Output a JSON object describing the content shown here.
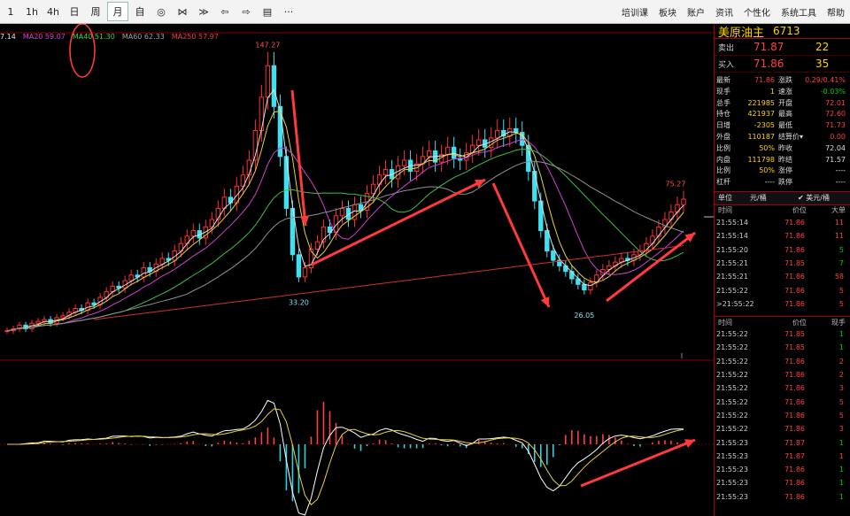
{
  "toolbar": {
    "buttons": [
      {
        "id": "1m",
        "label": "1"
      },
      {
        "id": "1h",
        "label": "1h"
      },
      {
        "id": "4h",
        "label": "4h"
      },
      {
        "id": "day",
        "label": "日"
      },
      {
        "id": "week",
        "label": "周"
      },
      {
        "id": "month",
        "label": "月",
        "selected": true
      },
      {
        "id": "custom",
        "label": "自"
      },
      {
        "id": "target",
        "label": "◎"
      },
      {
        "id": "bowtie",
        "label": "⋈"
      },
      {
        "id": "fold",
        "label": "≫"
      },
      {
        "id": "back",
        "label": "⇦"
      },
      {
        "id": "fwd",
        "label": "⇨"
      },
      {
        "id": "layout",
        "label": "▤"
      },
      {
        "id": "more",
        "label": "···"
      }
    ],
    "menus": [
      "培训课",
      "板块",
      "账户",
      "资讯",
      "个性化",
      "系统工具",
      "帮助"
    ]
  },
  "ma_legend": [
    {
      "label": "7.14",
      "color": "#e0e0e0"
    },
    {
      "label": "MA20 59.07",
      "color": "#d040d0"
    },
    {
      "label": "MA40 51.30",
      "color": "#40d040"
    },
    {
      "label": "MA60 62.33",
      "color": "#a0a0a0"
    },
    {
      "label": "MA250 57.97",
      "color": "#e04040"
    }
  ],
  "annotations": {
    "high": "147.27",
    "low1": "33.20",
    "low2": "26.05",
    "recent": "75.27"
  },
  "chart_data": {
    "type": "candlestick",
    "price_series": [
      4,
      5,
      7,
      5,
      8,
      9,
      10,
      8,
      11,
      12,
      14,
      16,
      15,
      19,
      18,
      22,
      25,
      28,
      27,
      31,
      34,
      33,
      38,
      36,
      40,
      43,
      42,
      47,
      51,
      55,
      58,
      54,
      60,
      64,
      70,
      76,
      73,
      82,
      88,
      96,
      112,
      130,
      147,
      125,
      98,
      70,
      45,
      33,
      38,
      48,
      52,
      60,
      57,
      66,
      70,
      64,
      72,
      69,
      78,
      83,
      88,
      91,
      86,
      93,
      96,
      90,
      94,
      98,
      101,
      95,
      99,
      103,
      97,
      96,
      100,
      104,
      107,
      103,
      108,
      112,
      109,
      113,
      111,
      104,
      90,
      74,
      58,
      47,
      42,
      39,
      36,
      32,
      29,
      26,
      30,
      34,
      37,
      39,
      41,
      43,
      42,
      45,
      47,
      51,
      55,
      60,
      64,
      68,
      72,
      75
    ],
    "ylim": [
      0,
      160
    ]
  },
  "panel": {
    "name": "美原油主",
    "code": "6713",
    "sell": {
      "label": "卖出",
      "price": "71.87",
      "vol": "22"
    },
    "buy": {
      "label": "买入",
      "price": "71.86",
      "vol": "35"
    },
    "quotes": [
      {
        "l1": "最新",
        "v1": "71.86",
        "c1": "#ff4040",
        "l2": "涨跌",
        "v2": "0.29/0.41%",
        "c2": "#ff4040"
      },
      {
        "l1": "现手",
        "v1": "1",
        "c1": "#ffd200",
        "l2": "速涨",
        "v2": "-0.03%",
        "c2": "#00d000"
      },
      {
        "l1": "总手",
        "v1": "221985",
        "c1": "#ffd200",
        "l2": "开盘",
        "v2": "72.01",
        "c2": "#ff4040"
      },
      {
        "l1": "持仓",
        "v1": "421937",
        "c1": "#ffd200",
        "l2": "最高",
        "v2": "72.60",
        "c2": "#ff4040"
      },
      {
        "l1": "日增",
        "v1": "-2305",
        "c1": "#ffd200",
        "l2": "最低",
        "v2": "71.73",
        "c2": "#ff4040"
      },
      {
        "l1": "外盘",
        "v1": "110187",
        "c1": "#ffd200",
        "l2": "结算价▾",
        "v2": "0.00",
        "c2": "#ff4040"
      },
      {
        "l1": "比例",
        "v1": "50%",
        "c1": "#ffd200",
        "l2": "昨收",
        "v2": "72.04",
        "c2": "#dddddd"
      },
      {
        "l1": "内盘",
        "v1": "111798",
        "c1": "#ffd200",
        "l2": "昨结",
        "v2": "71.57",
        "c2": "#dddddd"
      },
      {
        "l1": "比例",
        "v1": "50%",
        "c1": "#ffd200",
        "l2": "涨停",
        "v2": "----",
        "c2": "#dddddd"
      },
      {
        "l1": "杠杆",
        "v1": "----",
        "c1": "#dddddd",
        "l2": "跌停",
        "v2": "----",
        "c2": "#dddddd"
      }
    ],
    "unit": {
      "label": "单位",
      "value": "元/桶",
      "alt": "✔ 美元/桶"
    },
    "big_head": {
      "t": "时间",
      "p": "价位",
      "v": "大单"
    },
    "big_rows": [
      {
        "t": "21:55:14",
        "p": "71.86",
        "v": "11",
        "c": "r"
      },
      {
        "t": "21:55:14",
        "p": "71.86",
        "v": "11",
        "c": "r"
      },
      {
        "t": "21:55:20",
        "p": "71.86",
        "v": "5",
        "c": "g"
      },
      {
        "t": "21:55:21",
        "p": "71.85",
        "v": "7",
        "c": "g"
      },
      {
        "t": "21:55:21",
        "p": "71.86",
        "v": "58",
        "c": "r"
      },
      {
        "t": "21:55:22",
        "p": "71.86",
        "v": "5",
        "c": "r"
      },
      {
        "t": ">21:55:22",
        "p": "71.86",
        "v": "5",
        "c": "r"
      }
    ],
    "tick_head": {
      "t": "时间",
      "p": "价位",
      "v": "现手"
    },
    "tick_rows": [
      {
        "t": "21:55:22",
        "p": "71.85",
        "v": "1",
        "c": "g"
      },
      {
        "t": "21:55:22",
        "p": "71.85",
        "v": "1",
        "c": "g"
      },
      {
        "t": "21:55:22",
        "p": "71.86",
        "v": "2",
        "c": "r"
      },
      {
        "t": "21:55:22",
        "p": "71.86",
        "v": "2",
        "c": "r"
      },
      {
        "t": "21:55:22",
        "p": "71.86",
        "v": "3",
        "c": "r"
      },
      {
        "t": "21:55:22",
        "p": "71.86",
        "v": "5",
        "c": "r"
      },
      {
        "t": "21:55:22",
        "p": "71.86",
        "v": "5",
        "c": "r"
      },
      {
        "t": "21:55:22",
        "p": "71.86",
        "v": "3",
        "c": "r"
      },
      {
        "t": "21:55:23",
        "p": "71.87",
        "v": "1",
        "c": "g"
      },
      {
        "t": "21:55:23",
        "p": "71.87",
        "v": "1",
        "c": "r"
      },
      {
        "t": "21:55:23",
        "p": "71.86",
        "v": "1",
        "c": "g"
      },
      {
        "t": "21:55:23",
        "p": "71.86",
        "v": "1",
        "c": "g"
      },
      {
        "t": "21:55:23",
        "p": "71.86",
        "v": "1",
        "c": "g"
      }
    ]
  }
}
